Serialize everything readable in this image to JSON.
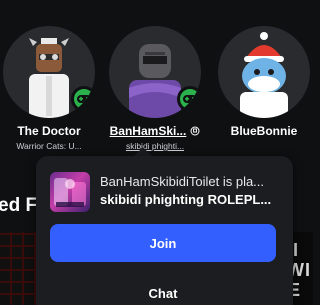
{
  "friends": [
    {
      "name": "The Doctor",
      "subtitle": "Warrior Cats: U...",
      "status": "in-game"
    },
    {
      "name": "BanHamSki...",
      "subtitle": "skibidi phighti...",
      "status": "in-game",
      "verified_icon": "premium-icon"
    },
    {
      "name": "BlueBonnie",
      "subtitle": "",
      "status": "none"
    }
  ],
  "section": {
    "heading": "ed F"
  },
  "popup": {
    "presence": "BanHamSkibidiToilet is pla...",
    "game_title": "skibidi phighting ROLEPL...",
    "join_label": "Join",
    "chat_label": "Chat"
  },
  "thumb_right_text": "ITI\nTWI\nSE",
  "colors": {
    "background": "#0f1012",
    "join": "#335fff",
    "online": "#2bb24c",
    "popup": "#1c1d20"
  },
  "icons": {
    "status": "gamepad-icon",
    "premium": "premium-icon"
  }
}
